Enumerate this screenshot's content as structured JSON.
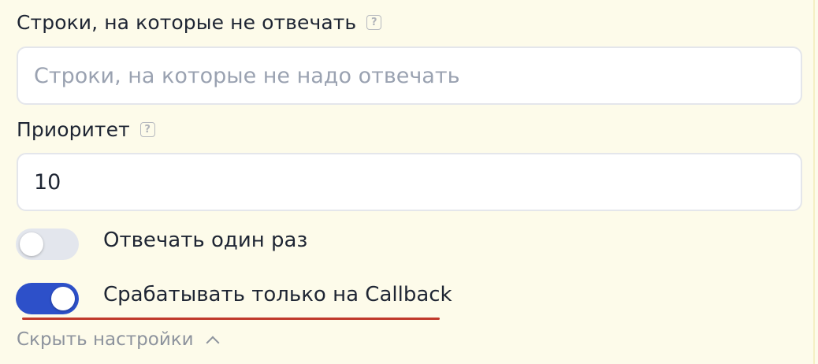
{
  "fields": {
    "ignore_lines": {
      "label": "Строки, на которые не отвечать",
      "placeholder": "Строки, на которые не надо отвечать",
      "value": ""
    },
    "priority": {
      "label": "Приоритет",
      "value": "10"
    }
  },
  "help_icon": {
    "glyph": "?"
  },
  "toggles": {
    "reply_once": {
      "label": "Отвечать один раз",
      "state": "off"
    },
    "callback_only": {
      "label": "Срабатывать только на Callback",
      "state": "on"
    }
  },
  "hide_settings": {
    "label": "Скрыть настройки",
    "icon": "chevron-up-icon"
  },
  "colors": {
    "panel_background": "#fdfbea",
    "toggle_on": "#2d50c9",
    "toggle_off": "#e3e6ed",
    "annotation_underline": "#c0392b"
  }
}
